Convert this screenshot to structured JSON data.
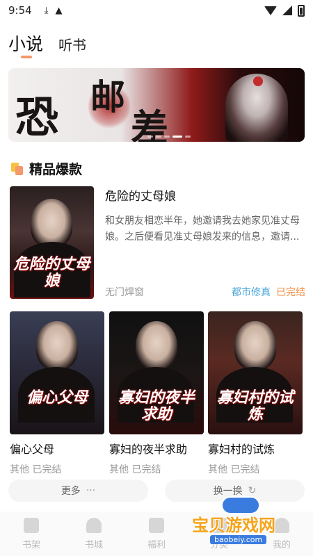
{
  "status_bar": {
    "time": "9:54"
  },
  "tabs": [
    {
      "label": "小说",
      "active": true
    },
    {
      "label": "听书",
      "active": false
    }
  ],
  "banner": {
    "title_chars": [
      "恐",
      "邮",
      "差"
    ],
    "dot_count": 5,
    "active_dot": 3
  },
  "section": {
    "title": "精品爆款"
  },
  "featured": {
    "cover_title": "危险的丈母娘",
    "title": "危险的丈母娘",
    "description": "和女朋友相恋半年，她邀请我去她家见准丈母娘。之后便看见准丈母娘发来的信息，邀请...",
    "author": "无门焊窗",
    "genre": "都市修真",
    "status": "已完结"
  },
  "books": [
    {
      "cover_title": "偏心父母",
      "title": "偏心父母",
      "meta": "其他 已完结"
    },
    {
      "cover_title": "寡妇的夜半求助",
      "title": "寡妇的夜半求助",
      "meta": "其他 已完结"
    },
    {
      "cover_title": "寡妇村的试炼",
      "title": "寡妇村的试炼",
      "meta": "其他 已完结"
    }
  ],
  "actions": {
    "more": "更多",
    "more_icon": "···",
    "refresh": "换一换",
    "refresh_icon": "↻"
  },
  "bottom_nav": [
    {
      "label": "书架",
      "icon": "bookshelf-icon"
    },
    {
      "label": "书城",
      "icon": "bookstore-icon"
    },
    {
      "label": "福利",
      "icon": "gift-icon"
    },
    {
      "label": "分类",
      "icon": "category-icon"
    },
    {
      "label": "我的",
      "icon": "profile-icon"
    }
  ],
  "watermark": {
    "text": "宝贝游戏网",
    "url": "baobeiy.com"
  },
  "colors": {
    "accent": "#f29a6a",
    "genre": "#4aa6d8",
    "status": "#f08a3c"
  }
}
